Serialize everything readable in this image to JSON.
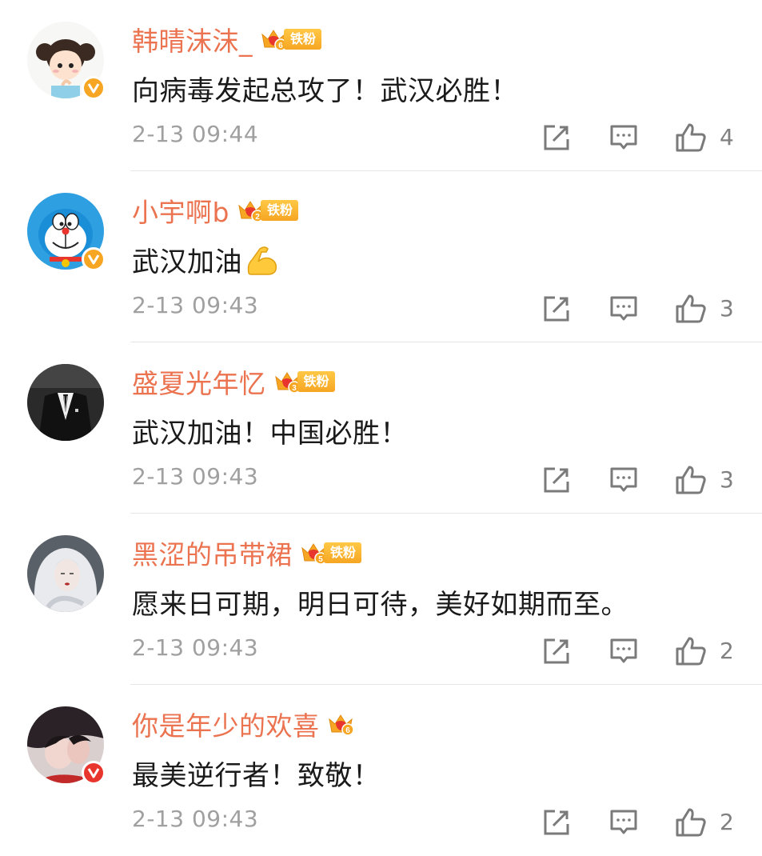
{
  "colors": {
    "name": "#eb7350",
    "badge_vip": "#f6a623",
    "badge_red": "#e8352e",
    "timestamp": "#a0a0a0"
  },
  "comments": [
    {
      "username": "韩晴沫沫_",
      "fan_level": "6",
      "fan_label": "铁粉",
      "verified": "yellow-v-badge",
      "text": "向病毒发起总攻了！武汉必胜！",
      "time": "2-13 09:44",
      "likes": "4"
    },
    {
      "username": "小宇啊b",
      "fan_level": "2",
      "fan_label": "铁粉",
      "verified": "yellow-v-badge",
      "text": "武汉加油",
      "emoji": "flexed-biceps-emoji",
      "time": "2-13 09:43",
      "likes": "3"
    },
    {
      "username": "盛夏光年忆",
      "fan_level": "3",
      "fan_label": "铁粉",
      "text": "武汉加油！中国必胜！",
      "time": "2-13 09:43",
      "likes": "3"
    },
    {
      "username": "黑涩的吊带裙",
      "fan_level": "5",
      "fan_label": "铁粉",
      "text": "愿来日可期，明日可待，美好如期而至。",
      "time": "2-13 09:43",
      "likes": "2"
    },
    {
      "username": "你是年少的欢喜",
      "fan_level": "6",
      "verified": "red-v-badge",
      "text": "最美逆行者！致敬！",
      "time": "2-13 09:43",
      "likes": "2"
    }
  ]
}
